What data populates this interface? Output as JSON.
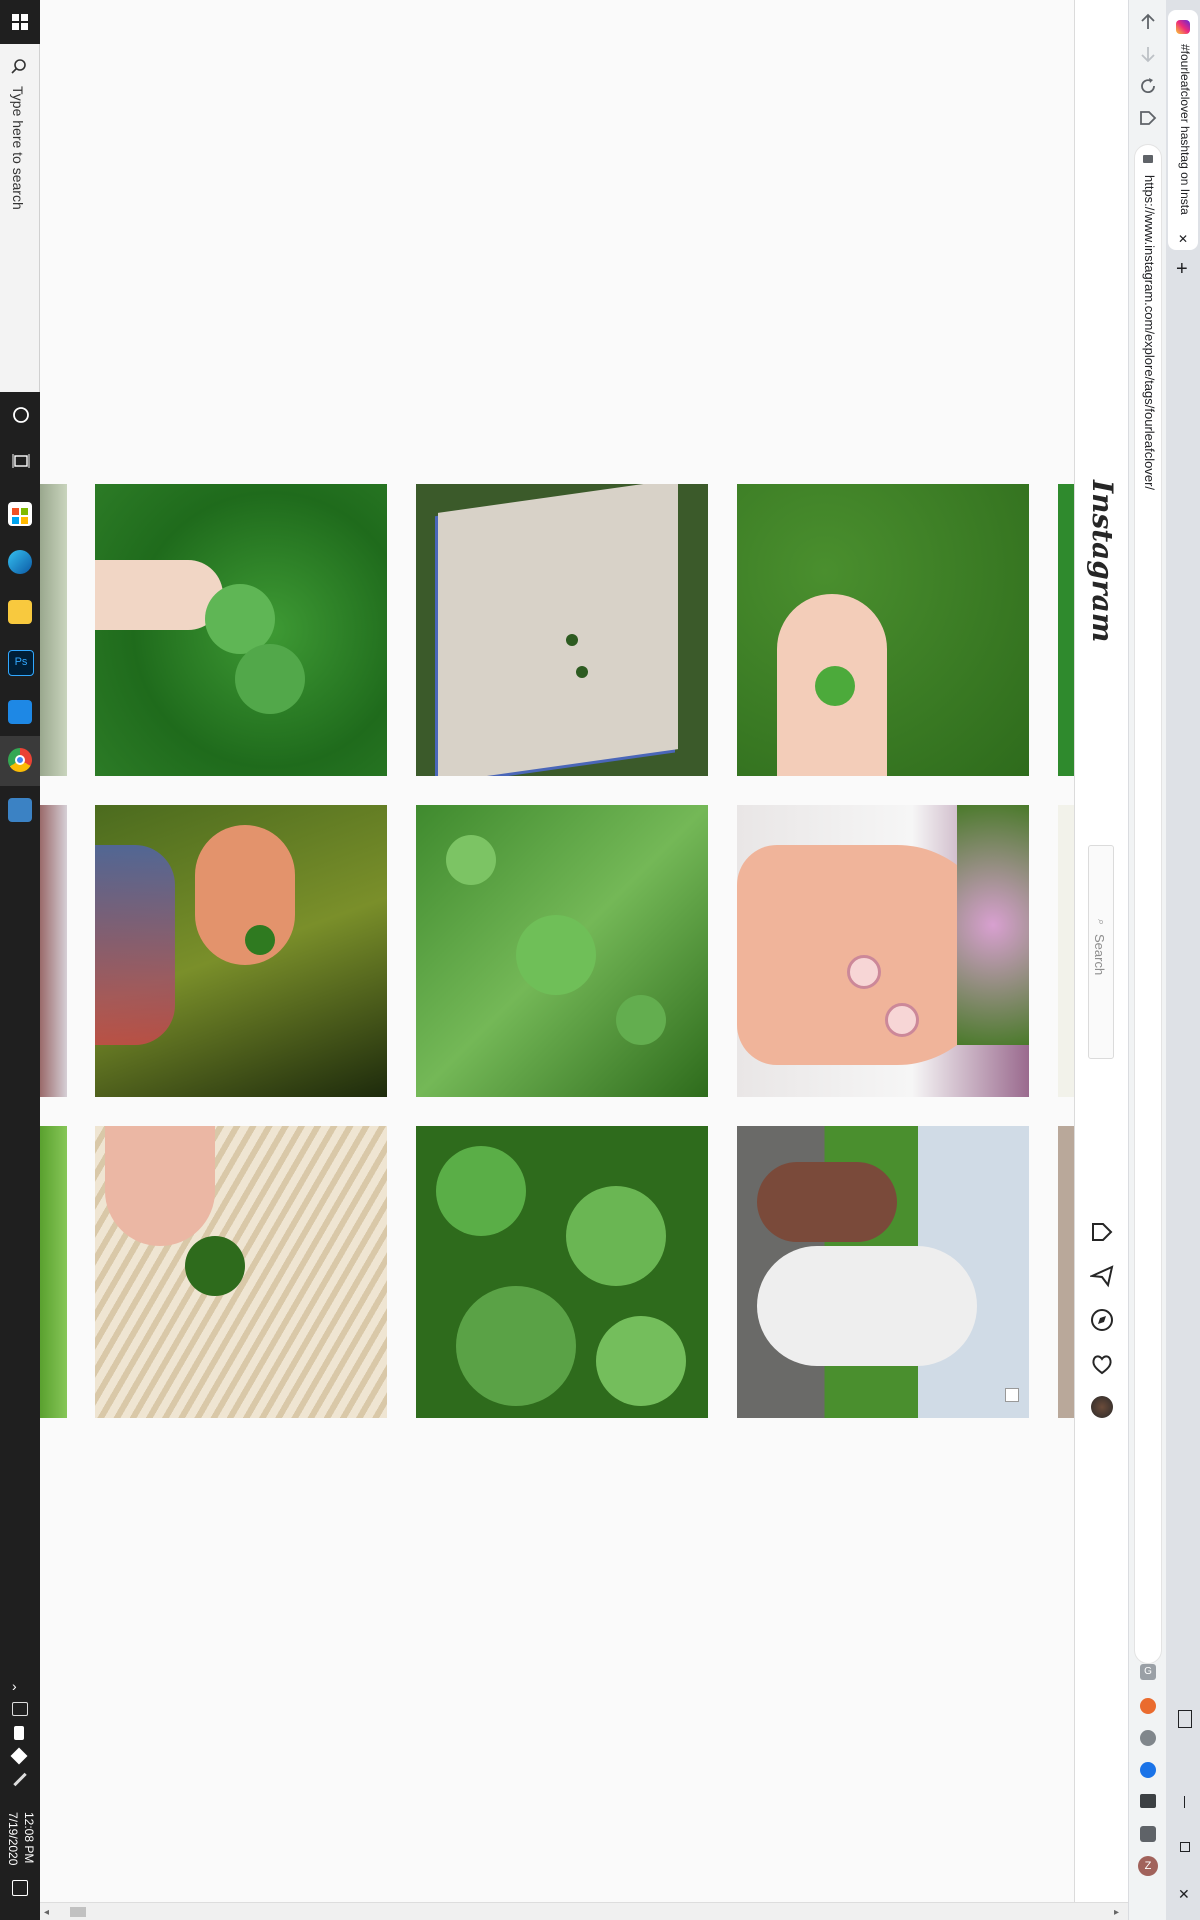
{
  "taskbar": {
    "search_placeholder": "Type here to search",
    "clock_time": "12:08 PM",
    "clock_date": "7/19/2020",
    "pinned_icons": [
      "cortana-icon",
      "task-view-icon",
      "store-icon",
      "edge-icon",
      "file-explorer-icon",
      "photoshop-icon",
      "vscode-icon",
      "chrome-icon",
      "settings-icon"
    ]
  },
  "browser": {
    "tab_title": "#fourleafclover hashtag on Insta",
    "url": "https://www.instagram.com/explore/tags/fourleafclover/",
    "new_tab_label": "+",
    "close_tab_label": "✕",
    "nav_icons": [
      "back-icon",
      "forward-icon",
      "reload-icon",
      "home-icon"
    ],
    "extension_icons": [
      "grammarly-icon",
      "ext-orange-icon",
      "ext-gray-icon",
      "ext-blue-icon",
      "ext-image-icon",
      "puzzle-icon",
      "profile-icon"
    ],
    "profile_initial": "Z",
    "window_controls": [
      "minimize-icon",
      "maximize-icon",
      "close-window-icon"
    ]
  },
  "instagram": {
    "logo": "Instagram",
    "search_placeholder": "Search",
    "nav_icons": [
      "home-icon",
      "direct-icon",
      "explore-icon",
      "activity-icon",
      "avatar"
    ]
  },
  "colors": {
    "taskbar": "#1f1f1f",
    "page_bg": "#fafafa",
    "clover_green": "#3f8a2e",
    "grass_dark": "#2e5c1e",
    "skin": "#f2c9b0"
  },
  "grid": {
    "tiles": [
      {
        "name": "photo-hand-clover-ivy",
        "desc": ""
      },
      {
        "name": "photo-notebook-clovers",
        "desc": ""
      },
      {
        "name": "photo-fingers-clover-field",
        "desc": ""
      },
      {
        "name": "photo-hand-clover-moss",
        "desc": ""
      },
      {
        "name": "photo-clover-grass",
        "desc": ""
      },
      {
        "name": "photo-clover-pins-palm",
        "desc": ""
      },
      {
        "name": "photo-clover-on-rug",
        "desc": ""
      },
      {
        "name": "photo-clover-leaves",
        "desc": ""
      },
      {
        "name": "photo-poodle-dogs",
        "desc": ""
      }
    ]
  }
}
